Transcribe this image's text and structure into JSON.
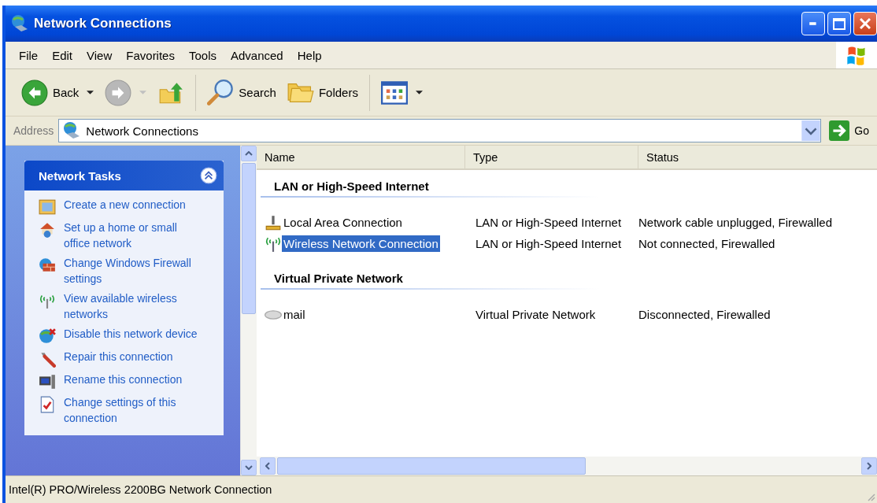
{
  "window": {
    "title": "Network Connections"
  },
  "menu": [
    "File",
    "Edit",
    "View",
    "Favorites",
    "Tools",
    "Advanced",
    "Help"
  ],
  "toolbar": [
    {
      "kind": "back",
      "label": "Back",
      "disabled": false
    },
    {
      "kind": "forward",
      "disabled": true
    },
    {
      "kind": "up"
    },
    {
      "kind": "separator"
    },
    {
      "kind": "search",
      "label": "Search"
    },
    {
      "kind": "folders",
      "label": "Folders"
    },
    {
      "kind": "separator"
    },
    {
      "kind": "views"
    }
  ],
  "address": {
    "label": "Address",
    "value": "Network Connections",
    "go": "Go"
  },
  "tasks": {
    "title": "Network Tasks",
    "expanded": true,
    "items": [
      "Create a new connection",
      "Set up a home or small office network",
      "Change Windows Firewall settings",
      "View available wireless networks",
      "Disable this network device",
      "Repair this connection",
      "Rename this connection",
      "Change settings of this connection"
    ]
  },
  "list": {
    "columns": [
      "Name",
      "Type",
      "Status"
    ],
    "groups": [
      {
        "title": "LAN or High-Speed Internet",
        "items": [
          {
            "name": "Local Area Connection",
            "type": "LAN or High-Speed Internet",
            "status": "Network cable unplugged, Firewalled",
            "selected": false
          },
          {
            "name": "Wireless Network Connection",
            "type": "LAN or High-Speed Internet",
            "status": "Not connected, Firewalled",
            "selected": true
          }
        ]
      },
      {
        "title": "Virtual Private Network",
        "items": [
          {
            "name": "mail",
            "type": "Virtual Private Network",
            "status": "Disconnected, Firewalled",
            "selected": false
          }
        ]
      }
    ]
  },
  "status_bar": "Intel(R) PRO/Wireless 2200BG Network Connection"
}
